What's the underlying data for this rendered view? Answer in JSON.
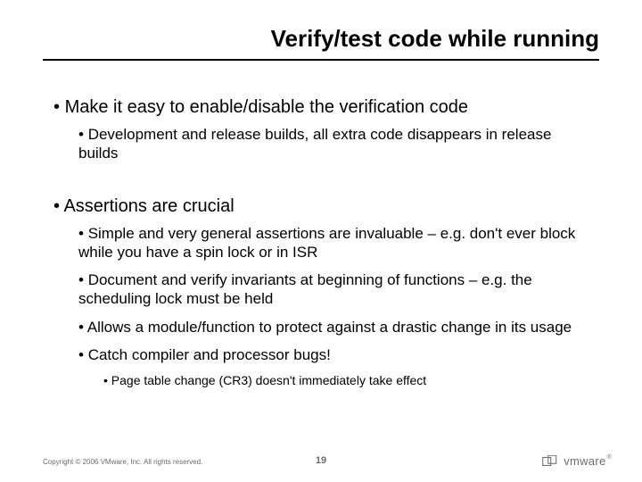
{
  "title": "Verify/test code while running",
  "bullets": {
    "b1a": "Make it easy to enable/disable the verification code",
    "b2a": "Development and release builds, all extra code disappears in release builds",
    "b1b": "Assertions are crucial",
    "b2b": "Simple and very general assertions are invaluable – e.g. don't ever block while you have a spin lock or in ISR",
    "b2c": "Document and verify invariants at beginning of functions – e.g. the scheduling lock must be held",
    "b2d": "Allows a module/function to protect against a drastic change in its usage",
    "b2e": "Catch compiler and processor bugs!",
    "b3a": "Page table change (CR3) doesn't immediately take effect"
  },
  "footer": {
    "copyright": "Copyright © 2006 VMware, Inc. All rights reserved.",
    "page": "19",
    "logo_text": "vmware"
  }
}
